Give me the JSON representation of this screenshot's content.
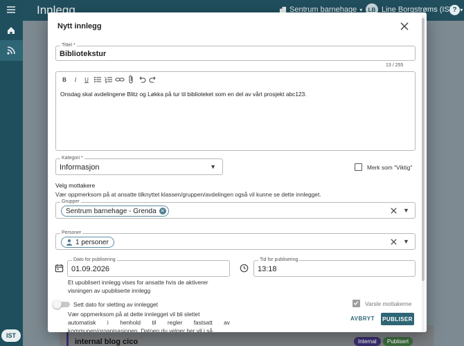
{
  "app": {
    "title": "Innlegg",
    "org": "Sentrum barnehage",
    "user_initials": "LB",
    "user_name": "Line Borgstrøms (IST)",
    "help": "?",
    "logo": "IST",
    "bg_card_title": "internal blog cico",
    "bg_chip_internal": "Internal",
    "bg_chip_published": "Publisert"
  },
  "dialog": {
    "title": "Nytt innlegg",
    "title_field": {
      "label": "Tittel *",
      "value": "Bibliotekstur",
      "counter": "13 / 255"
    },
    "editor": {
      "content": "Onsdag skal avdelingene Blitz og Løkka på tur til biblioteket som en del av vårt prosjekt abc123.",
      "tools": [
        "bold-icon",
        "italic-icon",
        "underline-icon",
        "bullet-list-icon",
        "numbered-list-icon",
        "link-icon",
        "attachment-icon",
        "undo-icon",
        "redo-icon"
      ]
    },
    "category": {
      "label": "Kategori *",
      "value": "Informasjon"
    },
    "important": {
      "label": "Merk som \"Viktig\"",
      "checked": false
    },
    "recipients": {
      "title": "Velg mottakere",
      "note": "Vær oppmerksom på at ansatte tilknyttet klassen/gruppen/avdelingen også vil kunne se dette innlegget.",
      "groups": {
        "label": "Grupper",
        "chip": "Sentrum barnehage - Grenda"
      },
      "persons": {
        "label": "Personer",
        "chip": "1 personer"
      }
    },
    "publish_date": {
      "label": "Dato for publisering",
      "value": "01.09.2026"
    },
    "publish_time": {
      "label": "Tid for publisering",
      "value": "13:18"
    },
    "publish_hint_line1": "Et upublisert innlegg vises for ansatte hvis de aktiverer",
    "publish_hint_line2": "visningen av upubliserte innlegg",
    "delete_toggle": {
      "label": "Sett dato for sletting av innlegget",
      "on": false
    },
    "delete_hint_line1": "Vær oppmerksom på at dette innlegget vil bli slettet",
    "delete_hint_line2": "automatisk i henhold til regler fastsatt av",
    "delete_hint_line3": "kommunen/organisasjonen. Datoen du velger her vil i så",
    "notify": {
      "label": "Varsle mottakerne",
      "checked": true
    },
    "cancel_label": "AVBRYT",
    "publish_label": "PUBLISER"
  },
  "colors": {
    "primary": "#2e6676",
    "sidebar": "#1f4f5d"
  }
}
